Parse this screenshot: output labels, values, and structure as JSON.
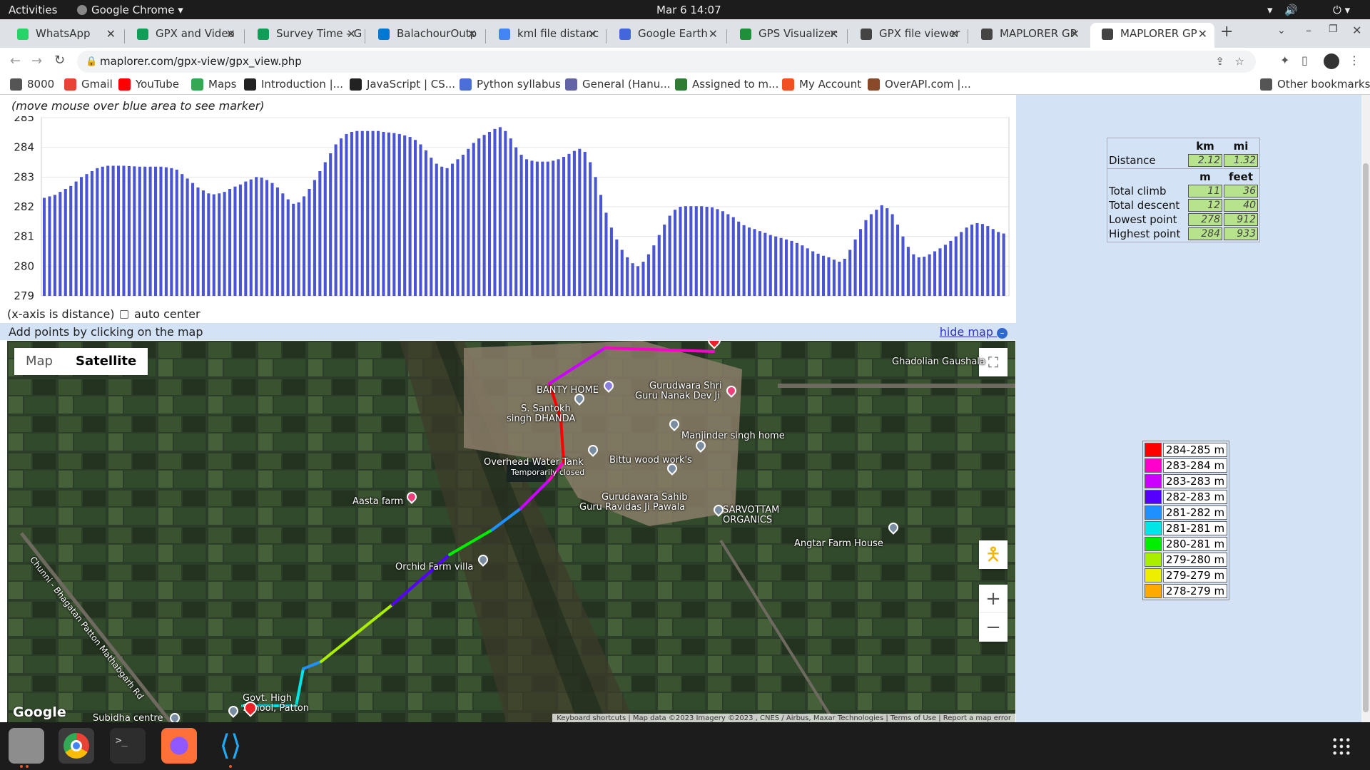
{
  "system": {
    "activities": "Activities",
    "app_name": "Google Chrome",
    "datetime": "Mar 6  14:07"
  },
  "tabs": [
    {
      "label": "WhatsApp",
      "color": "#25d366"
    },
    {
      "label": "GPX and Video",
      "color": "#0f9d58"
    },
    {
      "label": "Survey Time - G",
      "color": "#0f9d58"
    },
    {
      "label": "BalachourOutp",
      "color": "#0078d4"
    },
    {
      "label": "kml file distanc",
      "color": "#4285f4"
    },
    {
      "label": "Google Earth",
      "color": "#4466dd"
    },
    {
      "label": "GPS Visualizer:",
      "color": "#1f8f3a"
    },
    {
      "label": "GPX file viewer",
      "color": "#444444"
    },
    {
      "label": "MAPLORER GP",
      "color": "#444444"
    },
    {
      "label": "MAPLORER GP",
      "color": "#444444"
    }
  ],
  "url": "maplorer.com/gpx-view/gpx_view.php",
  "bookmarks": [
    {
      "label": "8000",
      "color": "#555555"
    },
    {
      "label": "Gmail",
      "color": "#ea4335"
    },
    {
      "label": "YouTube",
      "color": "#ff0000"
    },
    {
      "label": "Maps",
      "color": "#34a853"
    },
    {
      "label": "Introduction |...",
      "color": "#222222"
    },
    {
      "label": "JavaScript | CS...",
      "color": "#222222"
    },
    {
      "label": "Python syllabus",
      "color": "#4a6fd8"
    },
    {
      "label": "General (Hanu...",
      "color": "#6264a7"
    },
    {
      "label": "Assigned to m...",
      "color": "#2e7d32"
    },
    {
      "label": "My Account",
      "color": "#f25022"
    },
    {
      "label": "OverAPI.com |...",
      "color": "#8a4a2a"
    }
  ],
  "other_bookmarks": "Other bookmarks",
  "profile": {
    "hint": "(move mouse over blue area to see marker)",
    "xlabel": "(x-axis is distance)",
    "auto_center": "auto center"
  },
  "chart_data": {
    "type": "bar",
    "title": "",
    "xlabel": "(x-axis is distance)",
    "ylabel": "",
    "ylim": [
      279,
      285
    ],
    "yticks": [
      "285",
      "284",
      "283",
      "282",
      "281",
      "280",
      "279"
    ],
    "color": "#4a55d4",
    "values": [
      282.3,
      282.35,
      282.4,
      282.5,
      282.6,
      282.7,
      282.85,
      283.0,
      283.1,
      283.2,
      283.3,
      283.35,
      283.38,
      283.38,
      283.38,
      283.38,
      283.37,
      283.36,
      283.35,
      283.35,
      283.35,
      283.35,
      283.35,
      283.33,
      283.3,
      283.25,
      283.1,
      282.95,
      282.8,
      282.65,
      282.55,
      282.45,
      282.42,
      282.45,
      282.5,
      282.6,
      282.68,
      282.75,
      282.85,
      282.92,
      283.0,
      282.98,
      282.9,
      282.8,
      282.65,
      282.45,
      282.25,
      282.1,
      282.15,
      282.35,
      282.6,
      282.9,
      283.2,
      283.5,
      283.8,
      284.1,
      284.3,
      284.45,
      284.52,
      284.55,
      284.55,
      284.55,
      284.55,
      284.55,
      284.52,
      284.5,
      284.48,
      284.45,
      284.4,
      284.35,
      284.25,
      284.1,
      283.9,
      283.65,
      283.45,
      283.35,
      283.3,
      283.45,
      283.6,
      283.75,
      283.95,
      284.15,
      284.3,
      284.42,
      284.52,
      284.62,
      284.68,
      284.55,
      284.3,
      284.0,
      283.75,
      283.6,
      283.55,
      283.52,
      283.52,
      283.52,
      283.55,
      283.6,
      283.68,
      283.78,
      283.88,
      283.95,
      283.85,
      283.5,
      283.0,
      282.4,
      281.8,
      281.3,
      280.9,
      280.55,
      280.3,
      280.1,
      280.0,
      280.15,
      280.4,
      280.7,
      281.05,
      281.4,
      281.7,
      281.9,
      282.0,
      282.02,
      282.02,
      282.02,
      282.02,
      282.0,
      281.98,
      281.92,
      281.85,
      281.75,
      281.65,
      281.5,
      281.38,
      281.3,
      281.25,
      281.18,
      281.12,
      281.05,
      281.0,
      280.95,
      280.9,
      280.85,
      280.78,
      280.7,
      280.6,
      280.5,
      280.42,
      280.35,
      280.3,
      280.22,
      280.15,
      280.25,
      280.55,
      280.9,
      281.25,
      281.55,
      281.75,
      281.9,
      282.05,
      281.95,
      281.75,
      281.4,
      281.0,
      280.65,
      280.4,
      280.3,
      280.32,
      280.4,
      280.5,
      280.6,
      280.72,
      280.85,
      281.0,
      281.15,
      281.3,
      281.4,
      281.45,
      281.42,
      281.35,
      281.25,
      281.15,
      281.1
    ]
  },
  "add_points": "Add points by clicking on the map",
  "hide_map": "hide map",
  "map": {
    "type_map": "Map",
    "type_satellite": "Satellite",
    "labels": [
      {
        "text": "Ghadolian Gaushala"
      },
      {
        "text": "BANTY HOME"
      },
      {
        "text": "Gurudwara Shri"
      },
      {
        "text": "Guru Nanak Dev Ji"
      },
      {
        "text": "S. Santokh"
      },
      {
        "text": "singh DHANDA"
      },
      {
        "text": "Manjinder singh home"
      },
      {
        "text": "Overhead Water Tank"
      },
      {
        "text": "Temporarily closed"
      },
      {
        "text": "Bittu wood work's"
      },
      {
        "text": "Aasta farm"
      },
      {
        "text": "Gurudawara Sahib"
      },
      {
        "text": "Guru Ravidas Ji Pawala"
      },
      {
        "text": "SARVOTTAM"
      },
      {
        "text": "ORGANICS"
      },
      {
        "text": "Angtar Farm House"
      },
      {
        "text": "Orchid Farm villa"
      },
      {
        "text": "Chunni - Bhagatan Patton Mathabgarh Rd"
      },
      {
        "text": "Govt. High"
      },
      {
        "text": "School, Patton"
      },
      {
        "text": "Subidha centre"
      }
    ],
    "google": "Google",
    "attribution": "Keyboard shortcuts | Map data ©2023 Imagery ©2023 , CNES / Airbus, Maxar Technologies | Terms of Use | Report a map error"
  },
  "stats": {
    "h_km": "km",
    "h_mi": "mi",
    "h_m": "m",
    "h_feet": "feet",
    "rows1": [
      {
        "label": "Distance",
        "a": "2.12",
        "b": "1.32"
      }
    ],
    "rows2": [
      {
        "label": "Total climb",
        "a": "11",
        "b": "36"
      },
      {
        "label": "Total descent",
        "a": "12",
        "b": "40"
      },
      {
        "label": "Lowest point",
        "a": "278",
        "b": "912"
      },
      {
        "label": "Highest point",
        "a": "284",
        "b": "933"
      }
    ]
  },
  "legend": [
    {
      "label": "284-285 m",
      "color": "#ff0000"
    },
    {
      "label": "283-284 m",
      "color": "#ff00cc"
    },
    {
      "label": "283-283 m",
      "color": "#cc00ff"
    },
    {
      "label": "282-283 m",
      "color": "#5500ff"
    },
    {
      "label": "281-282 m",
      "color": "#1e90ff"
    },
    {
      "label": "281-281 m",
      "color": "#00e5e5"
    },
    {
      "label": "280-281 m",
      "color": "#00ee00"
    },
    {
      "label": "279-280 m",
      "color": "#aaee00"
    },
    {
      "label": "279-279 m",
      "color": "#eeee00"
    },
    {
      "label": "278-279 m",
      "color": "#ffaa00"
    }
  ]
}
